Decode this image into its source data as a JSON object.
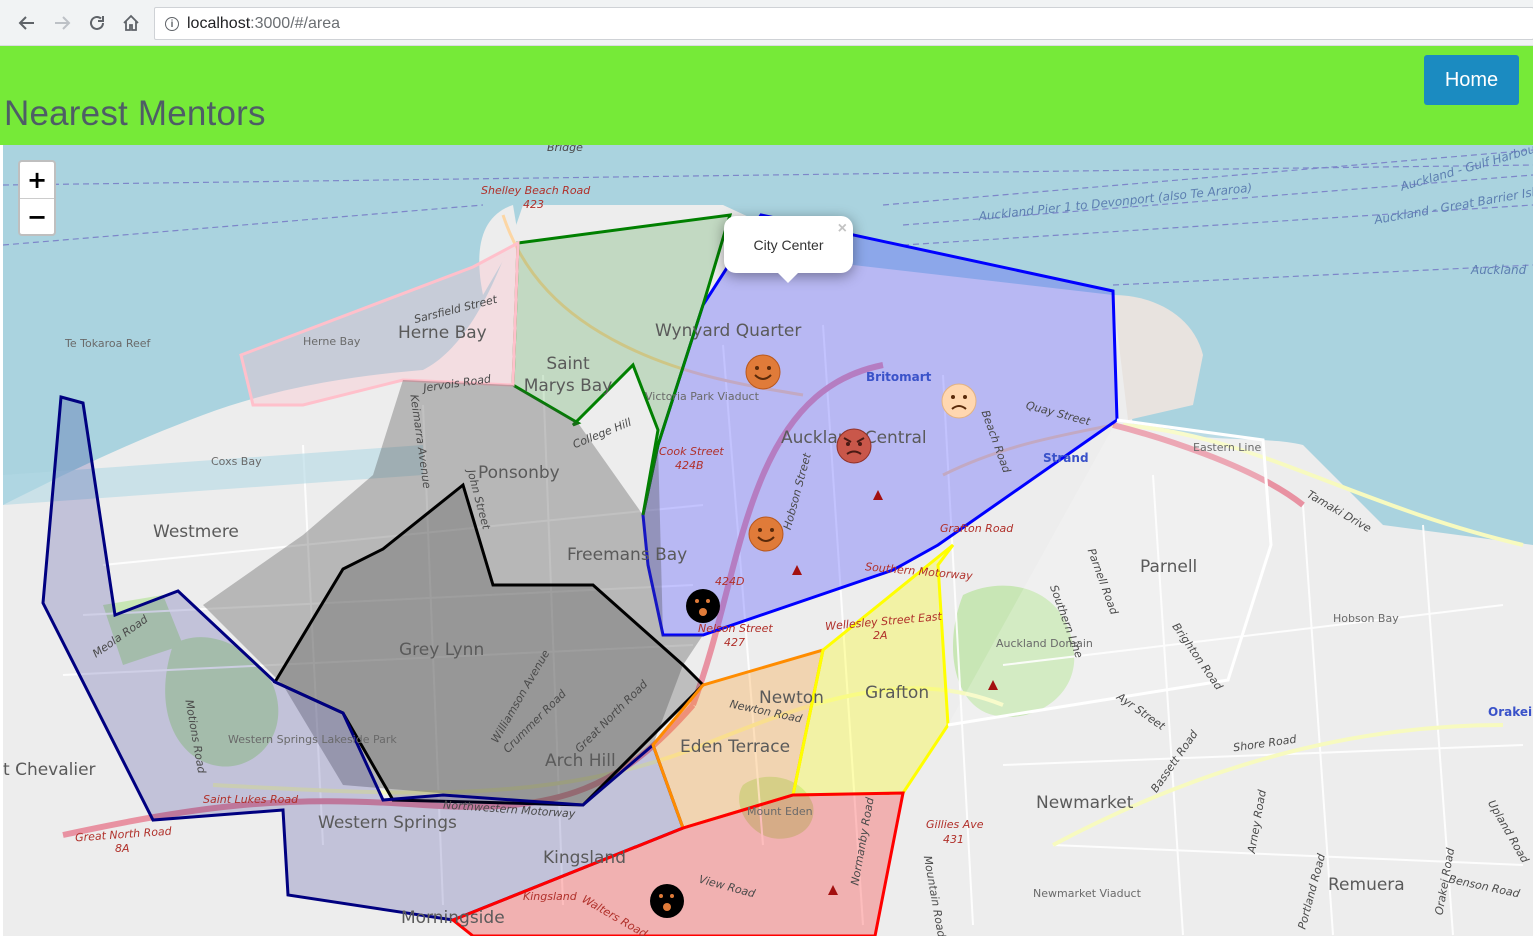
{
  "browser": {
    "url_host": "localhost",
    "url_path": ":3000/#/area"
  },
  "header": {
    "title": "Nearest Mentors",
    "home_label": "Home"
  },
  "map": {
    "zoom_in_label": "+",
    "zoom_out_label": "−",
    "popup": {
      "text": "City Center",
      "close_label": "×"
    },
    "area_labels": [
      "Herne Bay",
      "Saint Marys Bay",
      "Ponsonby",
      "Westmere",
      "Freemans Bay",
      "Grey Lynn",
      "Arch Hill",
      "Western Springs",
      "Kingsland",
      "Morningside",
      "Eden Terrace",
      "Newton",
      "Grafton",
      "Parnell",
      "Newmarket",
      "Remuera",
      "Wynyard Quarter",
      "Auckland Central",
      "t Chevalier"
    ],
    "place_labels": [
      "Herne Bay",
      "Coxs Bay",
      "Te Tokaroa Reef",
      "Victoria Park Viaduct",
      "Britomart",
      "Strand",
      "Auckland Domain",
      "Hobson Bay",
      "Mount Eden",
      "Newmarket Viaduct",
      "Western Springs Lakeside Park",
      "Orakei",
      "Eastern Line"
    ],
    "road_labels": [
      "Shelley Beach Road",
      "423",
      "Sarsfield Street",
      "Jervois Road",
      "Keimarra Avenue",
      "John Street",
      "Cook Street",
      "424B",
      "Hobson Street",
      "424D",
      "Nelson Street",
      "427",
      "Southern Motorway",
      "Wellesley Street East",
      "2A",
      "Grafton Road",
      "Quay Street",
      "Beach Road",
      "Tamaki Drive",
      "Shore Road",
      "Ayr Street",
      "Newton Road",
      "Great North Road",
      "8A",
      "Northwestern Motorway",
      "Saint Lukes Road",
      "Kingsland",
      "View Road",
      "Walters Road",
      "Gillies Ave",
      "431",
      "Meola Road",
      "Motions Road",
      "Crummer Road",
      "Williamson Avenue",
      "Great North Road",
      "Bassett Road",
      "Portland Road",
      "Orakei Road",
      "Benson Road",
      "Upland Road",
      "Arney Road",
      "Brighton Road",
      "Parnell Road",
      "Southern Line",
      "Mountain Road",
      "Normanby Road",
      "College Hill",
      "Bridge"
    ],
    "sea_labels": [
      "Auckland Pier 1 to Devonport (also Te Araroa)",
      "Auckland - Gulf Harbour",
      "Auckland - Great Barrier Island",
      "Auckland"
    ],
    "markers": [
      {
        "mood": "happy",
        "color": "#e07b39"
      },
      {
        "mood": "sad",
        "color": "#ffd7b0"
      },
      {
        "mood": "angry",
        "color": "#c9574a"
      },
      {
        "mood": "happy",
        "color": "#e07b39"
      },
      {
        "mood": "shocked",
        "color": "#000000"
      },
      {
        "mood": "shocked",
        "color": "#000000"
      }
    ],
    "colors": {
      "green_region": "#008000",
      "blue_region": "#0000ff",
      "pink_region": "#ffc0cb",
      "black_region": "#000000",
      "navy_region": "#000080",
      "yellow_region": "#ffff00",
      "orange_region": "#ff8c00",
      "red_region": "#ff0000",
      "white_region": "#ffffff"
    }
  }
}
